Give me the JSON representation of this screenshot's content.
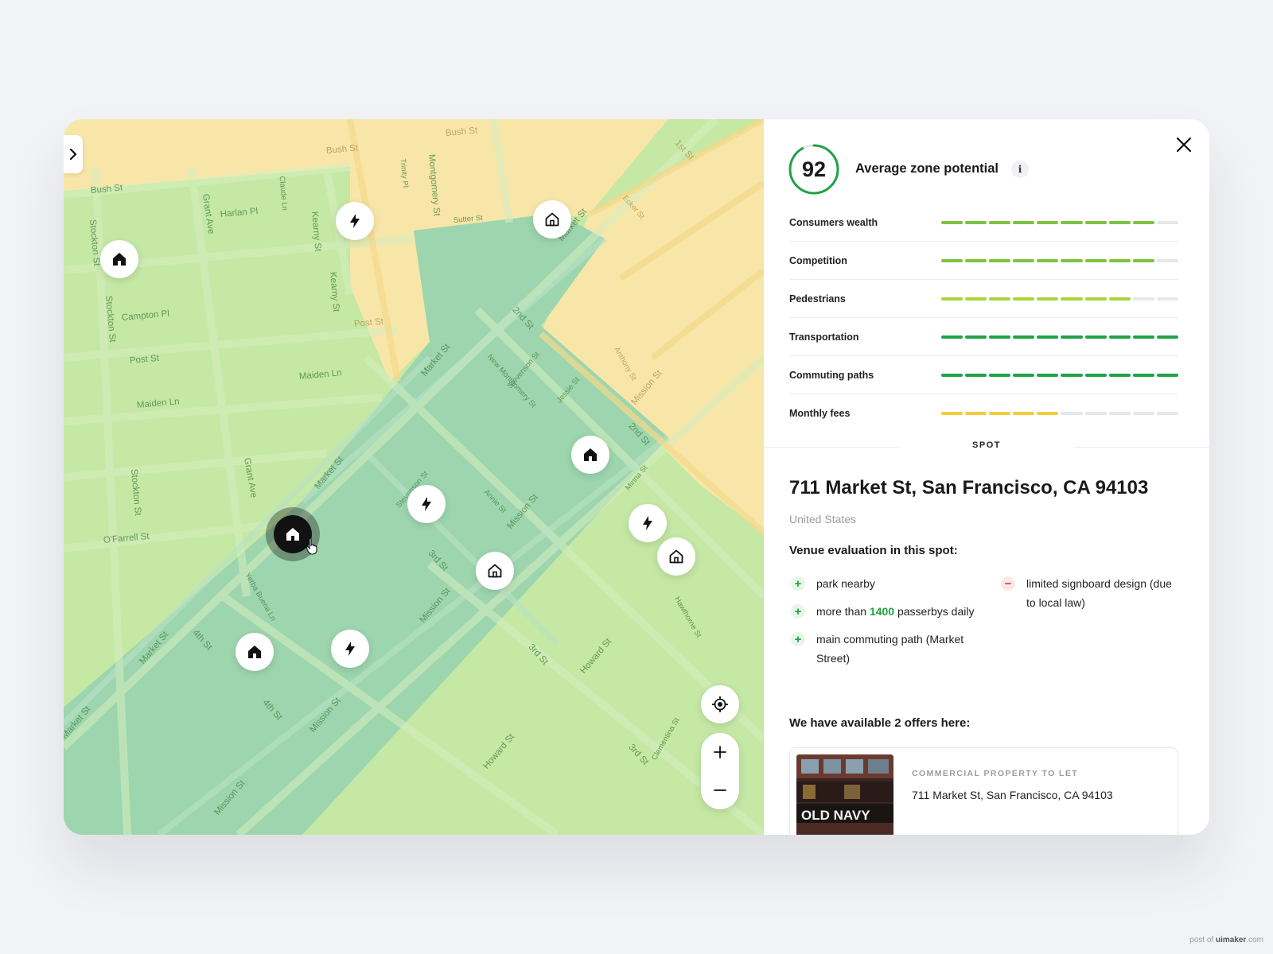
{
  "map": {
    "street_labels": [
      "Bush St",
      "Bush St",
      "Bush St",
      "Harlan Pl",
      "Campton Pl",
      "Post St",
      "Post St",
      "Maiden Ln",
      "Maiden Ln",
      "O'Farrell St",
      "Kearny St",
      "Kearny St",
      "Grant Ave",
      "Grant Ave",
      "Stockton St",
      "Stockton St",
      "Stockton St",
      "Market St",
      "Market St",
      "Market St",
      "Market St",
      "Market St",
      "2nd St",
      "2nd St",
      "Mission St",
      "Mission St",
      "Mission St",
      "Mission St",
      "Mission St",
      "3rd St",
      "3rd St",
      "3rd St",
      "4th St",
      "4th St",
      "Howard St",
      "Howard St",
      "Montgomery St",
      "New Montgomery St",
      "Stevenson St",
      "Stevenson St",
      "Jessie St",
      "Sutter St",
      "1st St",
      "Ecker St",
      "Minna St",
      "Yerba Buena Ln",
      "Annie St",
      "Anthony St",
      "Trinity Pl",
      "Claude Ln",
      "Hawthorne St",
      "Clementina St"
    ],
    "pins": [
      {
        "type": "home",
        "active": false
      },
      {
        "type": "charge",
        "active": false
      },
      {
        "type": "home",
        "active": false
      },
      {
        "type": "home",
        "active": false
      },
      {
        "type": "charge",
        "active": false
      },
      {
        "type": "home",
        "active": true
      },
      {
        "type": "home",
        "active": false
      },
      {
        "type": "charge",
        "active": false
      },
      {
        "type": "home",
        "active": false
      },
      {
        "type": "home",
        "active": false
      },
      {
        "type": "charge",
        "active": false
      }
    ],
    "zone_colors": {
      "high": "#9dd5ae",
      "mid": "#c5e8a5",
      "low": "#f8e6a8"
    }
  },
  "panel": {
    "score": "92",
    "score_fraction": 0.92,
    "score_title": "Average zone potential",
    "info_icon": "i",
    "metrics": [
      {
        "label": "Consumers wealth",
        "filled": 9,
        "total": 10,
        "color": "#7cc23e"
      },
      {
        "label": "Competition",
        "filled": 9,
        "total": 10,
        "color": "#7cc23e"
      },
      {
        "label": "Pedestrians",
        "filled": 8,
        "total": 10,
        "color": "#a8d63a"
      },
      {
        "label": "Transportation",
        "filled": 10,
        "total": 10,
        "color": "#1fa346"
      },
      {
        "label": "Commuting paths",
        "filled": 10,
        "total": 10,
        "color": "#1fa346"
      },
      {
        "label": "Monthly fees",
        "filled": 5,
        "total": 10,
        "color": "#f5cc3a"
      }
    ],
    "spot_label": "SPOT",
    "address": "711 Market St, San Francisco, CA 94103",
    "country": "United States",
    "evaluation_title": "Venue evaluation in this spot:",
    "pros": [
      {
        "before": "park nearby",
        "highlight": "",
        "after": ""
      },
      {
        "before": "more than ",
        "highlight": "1400",
        "after": " passerbys daily"
      },
      {
        "before": "main commuting path (Market Street)",
        "highlight": "",
        "after": ""
      }
    ],
    "cons": [
      {
        "text": "limited signboard design (due to local law)"
      }
    ],
    "offers_title": "We have available 2 offers here:",
    "offer": {
      "type": "COMMERCIAL PROPERTY TO LET",
      "address": "711 Market St, San Francisco, CA 94103",
      "sign": "OLD NAVY"
    }
  },
  "credit": {
    "prefix": "post of ",
    "brand": "uimaker",
    "suffix": ".com"
  }
}
